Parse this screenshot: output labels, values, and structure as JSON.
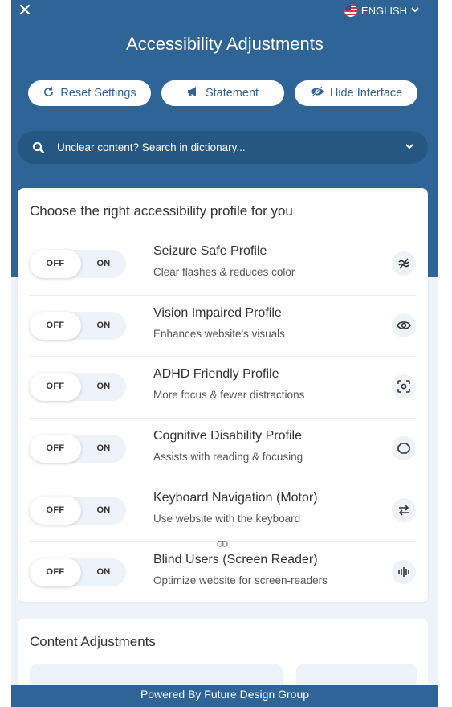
{
  "header": {
    "close_label": "✕",
    "language": "ENGLISH",
    "title": "Accessibility Adjustments",
    "buttons": {
      "reset": "Reset Settings",
      "statement": "Statement",
      "hide": "Hide Interface"
    },
    "search_placeholder": "Unclear content? Search in dictionary..."
  },
  "profiles": {
    "title": "Choose the right accessibility profile for you",
    "off_label": "OFF",
    "on_label": "ON",
    "items": [
      {
        "title": "Seizure Safe Profile",
        "desc": "Clear flashes & reduces color",
        "icon": "flash-waves-icon",
        "state": "off"
      },
      {
        "title": "Vision Impaired Profile",
        "desc": "Enhances website's visuals",
        "icon": "eye-icon",
        "state": "off"
      },
      {
        "title": "ADHD Friendly Profile",
        "desc": "More focus & fewer distractions",
        "icon": "focus-target-icon",
        "state": "off"
      },
      {
        "title": "Cognitive Disability Profile",
        "desc": "Assists with reading & focusing",
        "icon": "brain-circle-icon",
        "state": "off"
      },
      {
        "title": "Keyboard Navigation (Motor)",
        "desc": "Use website with the keyboard",
        "icon": "arrows-swap-icon",
        "state": "off"
      },
      {
        "title": "Blind Users (Screen Reader)",
        "desc": "Optimize website for screen-readers",
        "icon": "audio-wave-icon",
        "state": "off"
      }
    ]
  },
  "content_adjustments": {
    "title": "Content Adjustments"
  },
  "footer": {
    "text": "Powered By Future Design Group"
  },
  "colors": {
    "brand": "#2f6497",
    "brand_dark": "#255783",
    "panel_bg": "#eef3fa"
  }
}
